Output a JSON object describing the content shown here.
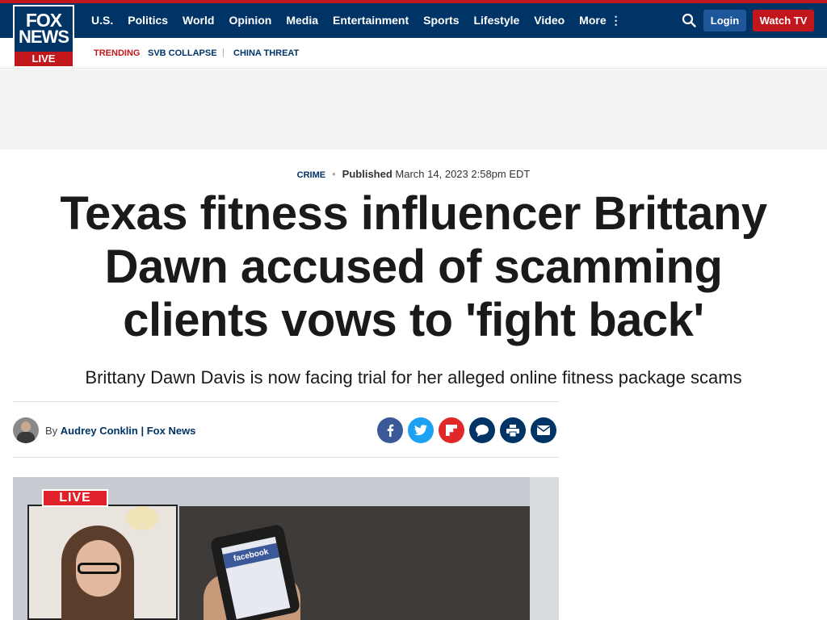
{
  "nav": {
    "logo_fox": "FOX",
    "logo_news": "NEWS",
    "logo_live": "LIVE",
    "items": [
      {
        "label": "U.S."
      },
      {
        "label": "Politics"
      },
      {
        "label": "World"
      },
      {
        "label": "Opinion"
      },
      {
        "label": "Media"
      },
      {
        "label": "Entertainment"
      },
      {
        "label": "Sports"
      },
      {
        "label": "Lifestyle"
      },
      {
        "label": "Video"
      },
      {
        "label": "More"
      }
    ],
    "more_dots": "⋮",
    "login_label": "Login",
    "watch_label": "Watch TV"
  },
  "trending": {
    "label": "TRENDING",
    "links": [
      {
        "label": "SVB COLLAPSE"
      },
      {
        "label": "CHINA THREAT"
      }
    ],
    "separator": "|"
  },
  "article": {
    "category": "CRIME",
    "dot": "•",
    "published_label": "Published",
    "published_date": "March 14, 2023 2:58pm EDT",
    "headline": "Texas fitness influencer Brittany Dawn accused of scamming clients vows to 'fight back'",
    "subhead": "Brittany Dawn Davis is now facing trial for her alleged online fitness package scams",
    "byline_prefix": "By",
    "author": "Audrey Conklin | Fox News"
  },
  "share_icons": [
    "facebook-icon",
    "twitter-icon",
    "flipboard-icon",
    "comment-icon",
    "print-icon",
    "email-icon"
  ],
  "hero": {
    "live_badge": "LIVE",
    "phone_text": "facebook"
  },
  "colors": {
    "nav_bg": "#003366",
    "accent_red": "#c2161d",
    "login_blue": "#1e5799",
    "facebook": "#3b5998",
    "twitter": "#1da1f2",
    "flipboard": "#e12828",
    "share_navy": "#003366"
  }
}
